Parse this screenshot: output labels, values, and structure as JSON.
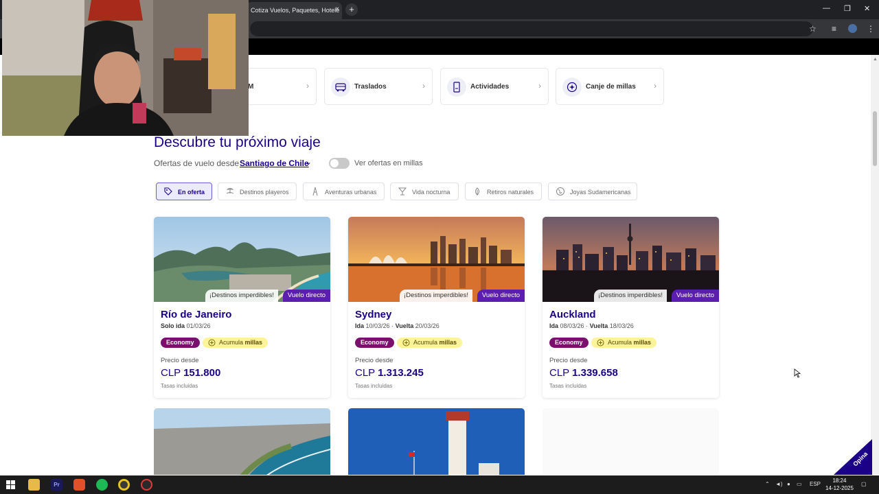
{
  "browser": {
    "tab_title": "Cotiza Vuelos, Paquetes, Hotele",
    "tab_close": "×",
    "new_tab": "+",
    "minimize": "—",
    "restore": "❐",
    "close": "✕"
  },
  "services": [
    {
      "label": "M",
      "icon": "hotel-icon"
    },
    {
      "label": "Traslados",
      "icon": "bus-icon"
    },
    {
      "label": "Actividades",
      "icon": "ticket-icon"
    },
    {
      "label": "Canje de millas",
      "icon": "sparkle-icon"
    }
  ],
  "discover": {
    "title": "Descubre tu próximo viaje",
    "offers_from": "Ofertas de vuelo desde",
    "origin": "Santiago de Chile",
    "toggle_label": "Ver ofertas en millas"
  },
  "filters": [
    {
      "label": "En oferta",
      "active": true
    },
    {
      "label": "Destinos playeros",
      "active": false
    },
    {
      "label": "Aventuras urbanas",
      "active": false
    },
    {
      "label": "Vida nocturna",
      "active": false
    },
    {
      "label": "Retiros naturales",
      "active": false
    },
    {
      "label": "Joyas Sudamericanas",
      "active": false
    }
  ],
  "destinations": [
    {
      "name": "Río de Janeiro",
      "date_prefix": "Solo ida",
      "date_out": "01/03/26",
      "return_prefix": "",
      "date_return": "",
      "tag": "¡Destinos imperdibles!",
      "direct": "Vuelo directo",
      "cabin": "Economy",
      "miles_prefix": "Acumula",
      "miles_word": "millas",
      "price_from": "Precio desde",
      "currency": "CLP",
      "price": "151.800",
      "taxes": "Tasas incluidas"
    },
    {
      "name": "Sydney",
      "date_prefix": "Ida",
      "date_out": "10/03/26",
      "return_prefix": "Vuelta",
      "date_return": "20/03/26",
      "tag": "¡Destinos imperdibles!",
      "direct": "Vuelo directo",
      "cabin": "Economy",
      "miles_prefix": "Acumula",
      "miles_word": "millas",
      "price_from": "Precio desde",
      "currency": "CLP",
      "price": "1.313.245",
      "taxes": "Tasas incluidas"
    },
    {
      "name": "Auckland",
      "date_prefix": "Ida",
      "date_out": "08/03/26",
      "return_prefix": "Vuelta",
      "date_return": "18/03/26",
      "tag": "¡Destinos imperdibles!",
      "direct": "Vuelo directo",
      "cabin": "Economy",
      "miles_prefix": "Acumula",
      "miles_word": "millas",
      "price_from": "Precio desde",
      "currency": "CLP",
      "price": "1.339.658",
      "taxes": "Tasas incluidas"
    }
  ],
  "feedback": {
    "label": "Opina"
  },
  "taskbar": {
    "tray_lang": "ESP",
    "time": "18:24",
    "date": "14-12-2025"
  },
  "colors": {
    "brand": "#1b0088",
    "direct_badge": "#5c1eb0",
    "economy": "#7a0f6e",
    "miles": "#fcf39b"
  }
}
